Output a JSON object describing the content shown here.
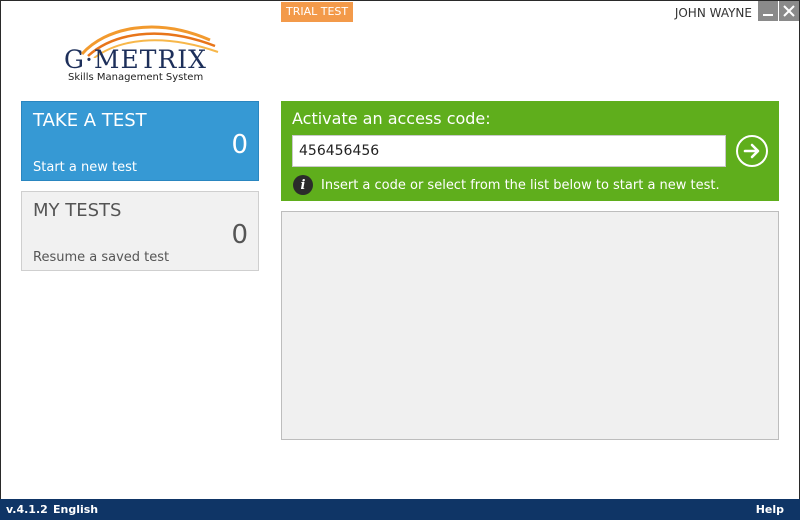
{
  "header": {
    "logo_text": "G·METRIX",
    "logo_subtitle": "Skills Management System",
    "trial_badge": "TRIAL TEST",
    "user_name": "JOHN WAYNE"
  },
  "tiles": {
    "take_test": {
      "title": "TAKE A TEST",
      "count": "0",
      "subtitle": "Start a new test"
    },
    "my_tests": {
      "title": "MY TESTS",
      "count": "0",
      "subtitle": "Resume a saved test"
    }
  },
  "activate": {
    "title": "Activate an access code:",
    "code_value": "456456456",
    "info_text": "Insert a code or select from the list below to start a new test."
  },
  "status_bar": {
    "version": "v.4.1.2",
    "language": "English",
    "help": "Help"
  },
  "colors": {
    "take_tile": "#3699d4",
    "activate_panel": "#5fae1c",
    "trial_badge": "#f39a4a",
    "status_bar": "#0f3566"
  },
  "icons": [
    "logo-swoosh-icon",
    "minimize-icon",
    "close-icon",
    "arrow-right-circle-icon",
    "info-icon"
  ]
}
